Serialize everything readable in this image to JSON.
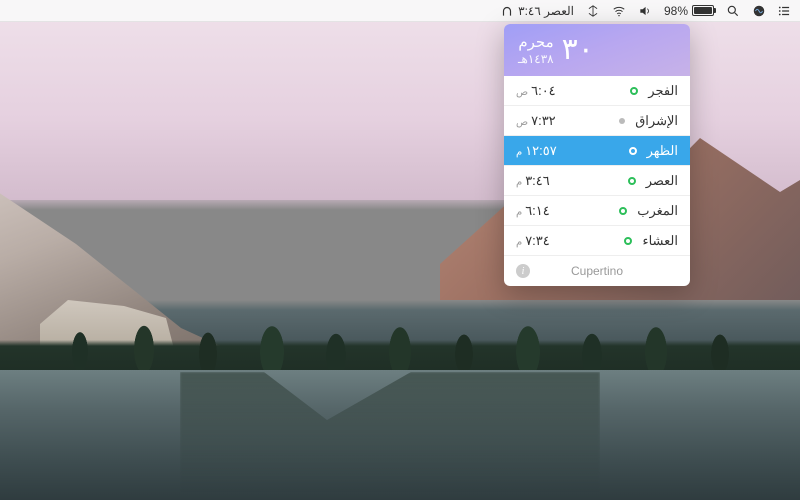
{
  "menubar": {
    "app_status": "العصر ٣:٤٦",
    "battery_pct": "98%"
  },
  "panel": {
    "day_number": "٣٠",
    "month": "محرم",
    "year": "١٤٣٨هـ",
    "location": "Cupertino"
  },
  "prayers": [
    {
      "name": "الفجر",
      "time": "٦:٠٤",
      "period": "ص",
      "indicator": "green",
      "active": false
    },
    {
      "name": "الإشراق",
      "time": "٧:٣٢",
      "period": "ص",
      "indicator": "gray",
      "active": false
    },
    {
      "name": "الظهر",
      "time": "١٢:٥٧",
      "period": "م",
      "indicator": "green",
      "active": true
    },
    {
      "name": "العصر",
      "time": "٣:٤٦",
      "period": "م",
      "indicator": "green",
      "active": false
    },
    {
      "name": "المغرب",
      "time": "٦:١٤",
      "period": "م",
      "indicator": "green",
      "active": false
    },
    {
      "name": "العشاء",
      "time": "٧:٣٤",
      "period": "م",
      "indicator": "green",
      "active": false
    }
  ]
}
